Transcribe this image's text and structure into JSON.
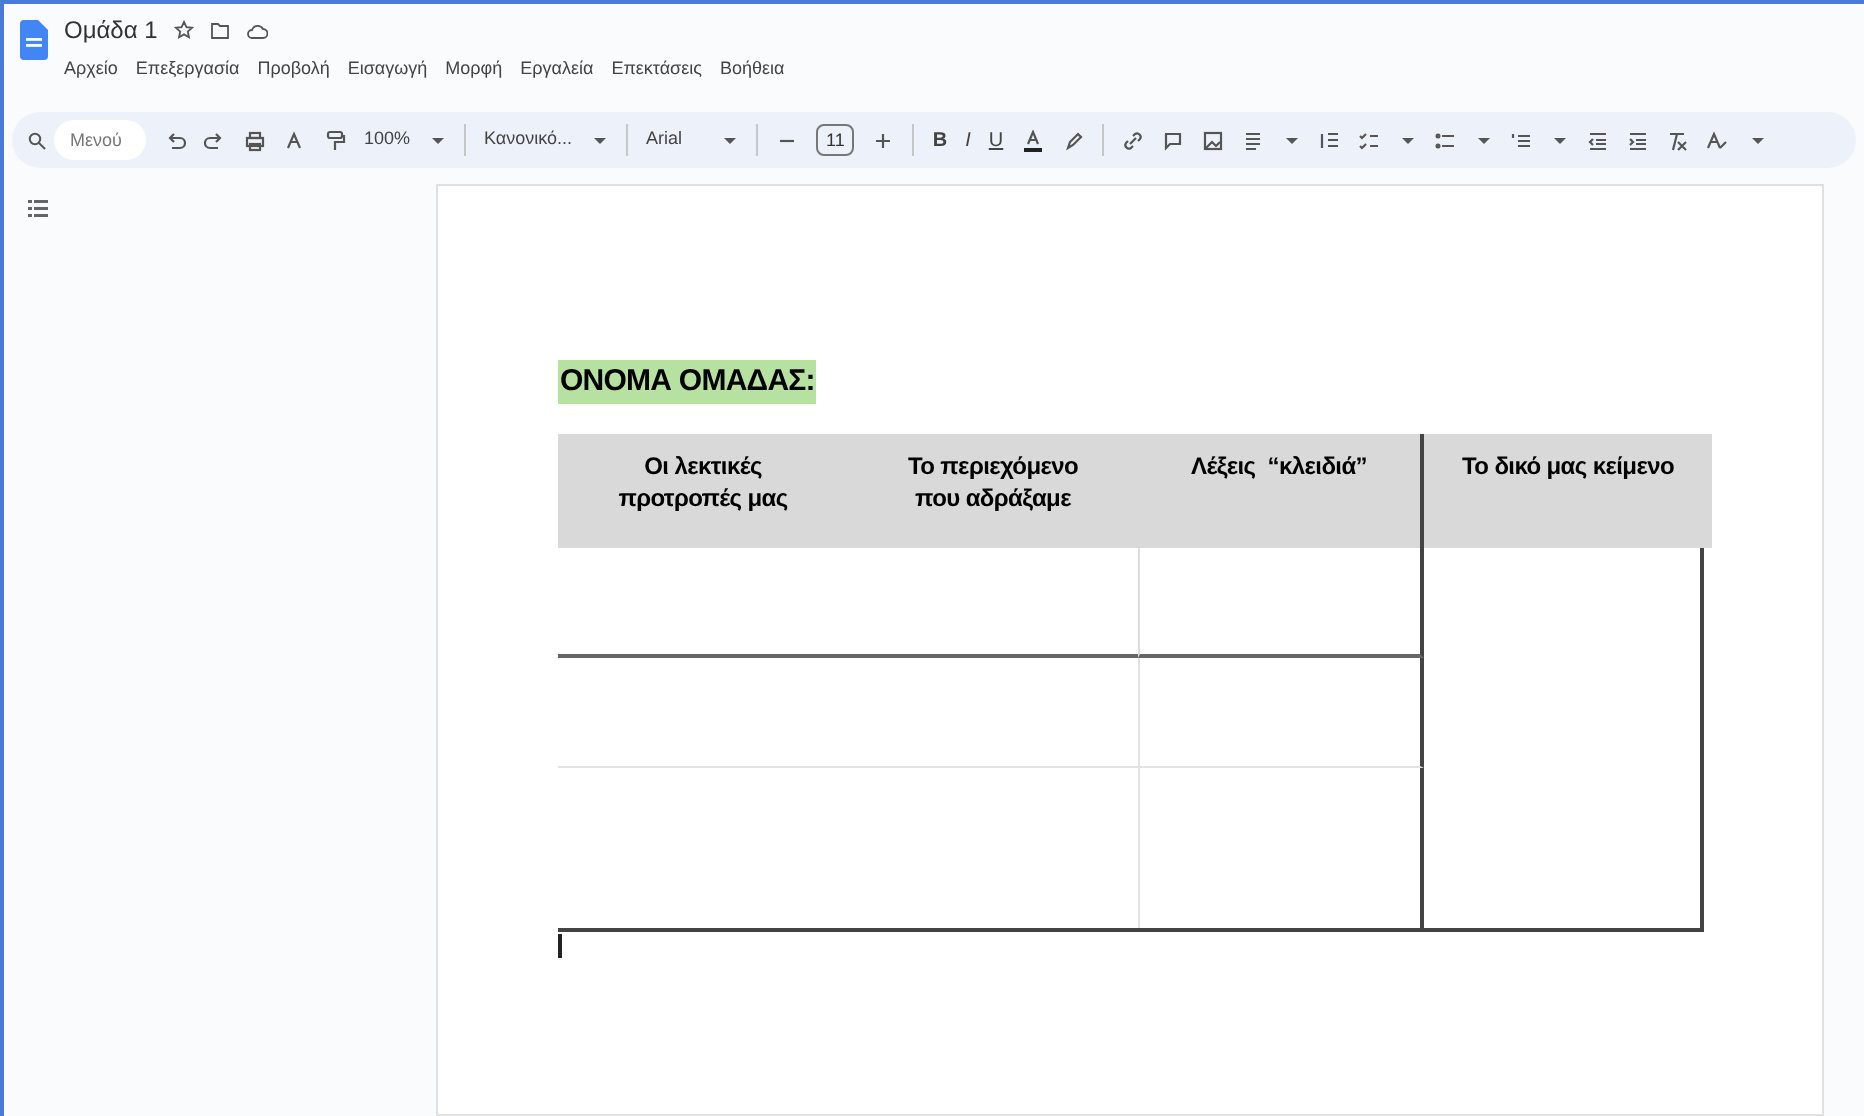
{
  "document": {
    "title": "Ομάδα 1"
  },
  "menu": [
    "Αρχείο",
    "Επεξεργασία",
    "Προβολή",
    "Εισαγωγή",
    "Μορφή",
    "Εργαλεία",
    "Επεκτάσεις",
    "Βοήθεια"
  ],
  "toolbar": {
    "search": {
      "placeholder": "Μενού"
    },
    "zoom": "100%",
    "style": "Κανονικό...",
    "font": "Arial",
    "font_size": "11",
    "format_buttons": [
      "B",
      "I",
      "U"
    ]
  },
  "page": {
    "heading": "ΟΝΟΜΑ ΟΜΑΔΑΣ:",
    "table": {
      "columns": [
        "Οι λεκτικές προτροπές μας",
        "Το περιεχόμενο που αδράξαμε",
        "Λέξεις  “κλειδιά”",
        "Το δικό μας κείμενο"
      ]
    }
  }
}
